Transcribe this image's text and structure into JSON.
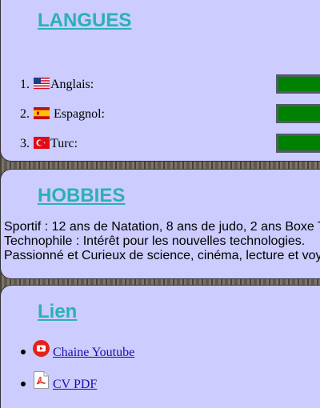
{
  "langues": {
    "title": "LANGUES",
    "items": [
      {
        "number": "1.",
        "label": "Anglais:",
        "flag": "us-flag-icon"
      },
      {
        "number": "2.",
        "label": " Espagnol:",
        "flag": "spain-flag-icon"
      },
      {
        "number": "3.",
        "label": "Turc:",
        "flag": "turkey-flag-icon"
      }
    ]
  },
  "hobbies": {
    "title": "HOBBIES",
    "lines": [
      "Sportif : 12 ans de Natation, 8 ans de judo, 2 ans Boxe T",
      "Technophile : Intérêt pour les nouvelles technologies.",
      "Passionné et Curieux de science, cinéma, lecture et voy"
    ]
  },
  "lien": {
    "title": "Lien",
    "links": [
      {
        "label": "Chaine Youtube",
        "icon": "youtube-icon"
      },
      {
        "label": "CV PDF",
        "icon": "pdf-icon"
      }
    ]
  },
  "colors": {
    "panel_bg": "#ccccff",
    "title": "#2ab0b8",
    "bar": "#008000",
    "link": "#1a0dab"
  }
}
